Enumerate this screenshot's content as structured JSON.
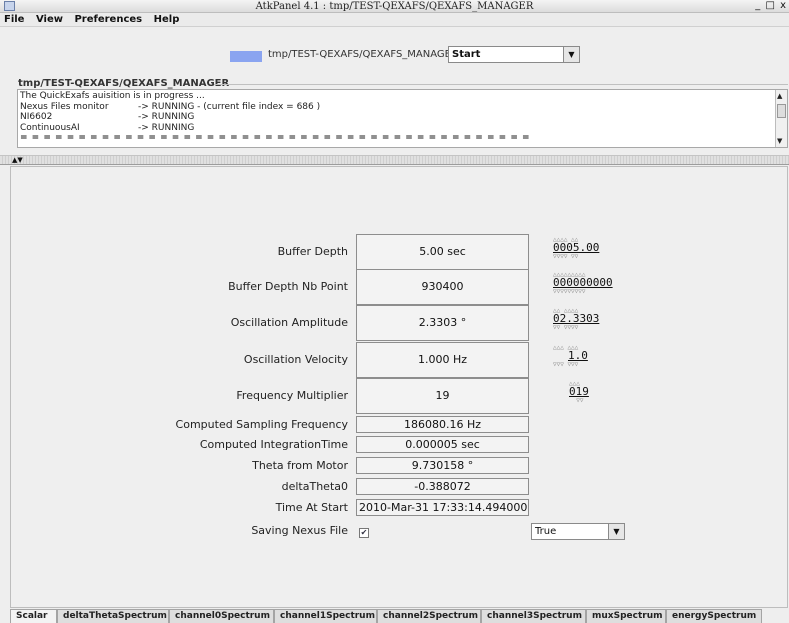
{
  "window": {
    "title": "AtkPanel 4.1 : tmp/TEST-QEXAFS/QEXAFS_MANAGER",
    "buttons": "_ □ x"
  },
  "menu": [
    "File",
    "View",
    "Preferences",
    "Help"
  ],
  "device": {
    "name": "tmp/TEST-QEXAFS/QEXAFS_MANAGER",
    "command": "Start",
    "state_color": "#8aa4f0"
  },
  "status": {
    "title": "tmp/TEST-QEXAFS/QEXAFS_MANAGER",
    "line1": "The QuickExafs auisition is in progress ...",
    "rows": [
      {
        "name": "Nexus Files monitor",
        "value": "-> RUNNING - (current file index = 686 )"
      },
      {
        "name": "NI6602",
        "value": "-> RUNNING"
      },
      {
        "name": "ContinuousAI",
        "value": "-> RUNNING"
      }
    ],
    "separator": "= = = = = = = = = = = = = = = = = = = = = = = = = = = = = = = = = = = = = = = = = = = ="
  },
  "attributes": [
    {
      "label": "Buffer Depth",
      "value": "5.00 sec",
      "wheel": "0005.00"
    },
    {
      "label": "Buffer Depth Nb Point",
      "value": "930400",
      "wheel": "000000000"
    },
    {
      "label": "Oscillation Amplitude",
      "value": "2.3303 °",
      "wheel": "02.3303"
    },
    {
      "label": "Oscillation Velocity",
      "value": "1.000 Hz",
      "wheel": "1.0"
    },
    {
      "label": "Frequency Multiplier",
      "value": "19",
      "wheel": "019"
    },
    {
      "label": "Computed Sampling Frequency",
      "value": "186080.16 Hz"
    },
    {
      "label": "Computed IntegrationTime",
      "value": "0.000005 sec"
    },
    {
      "label": "Theta from Motor",
      "value": "9.730158 °"
    },
    {
      "label": "deltaTheta0",
      "value": "-0.388072"
    },
    {
      "label": "Time At Start",
      "value": "2010-Mar-31 17:33:14.494000"
    },
    {
      "label": "Saving Nexus File",
      "checked": true,
      "select_value": "True"
    }
  ],
  "tabs": [
    "Scalar",
    "deltaThetaSpectrum",
    "channel0Spectrum",
    "channel1Spectrum",
    "channel2Spectrum",
    "channel3Spectrum",
    "muxSpectrum",
    "energySpectrum"
  ],
  "active_tab": "Scalar"
}
